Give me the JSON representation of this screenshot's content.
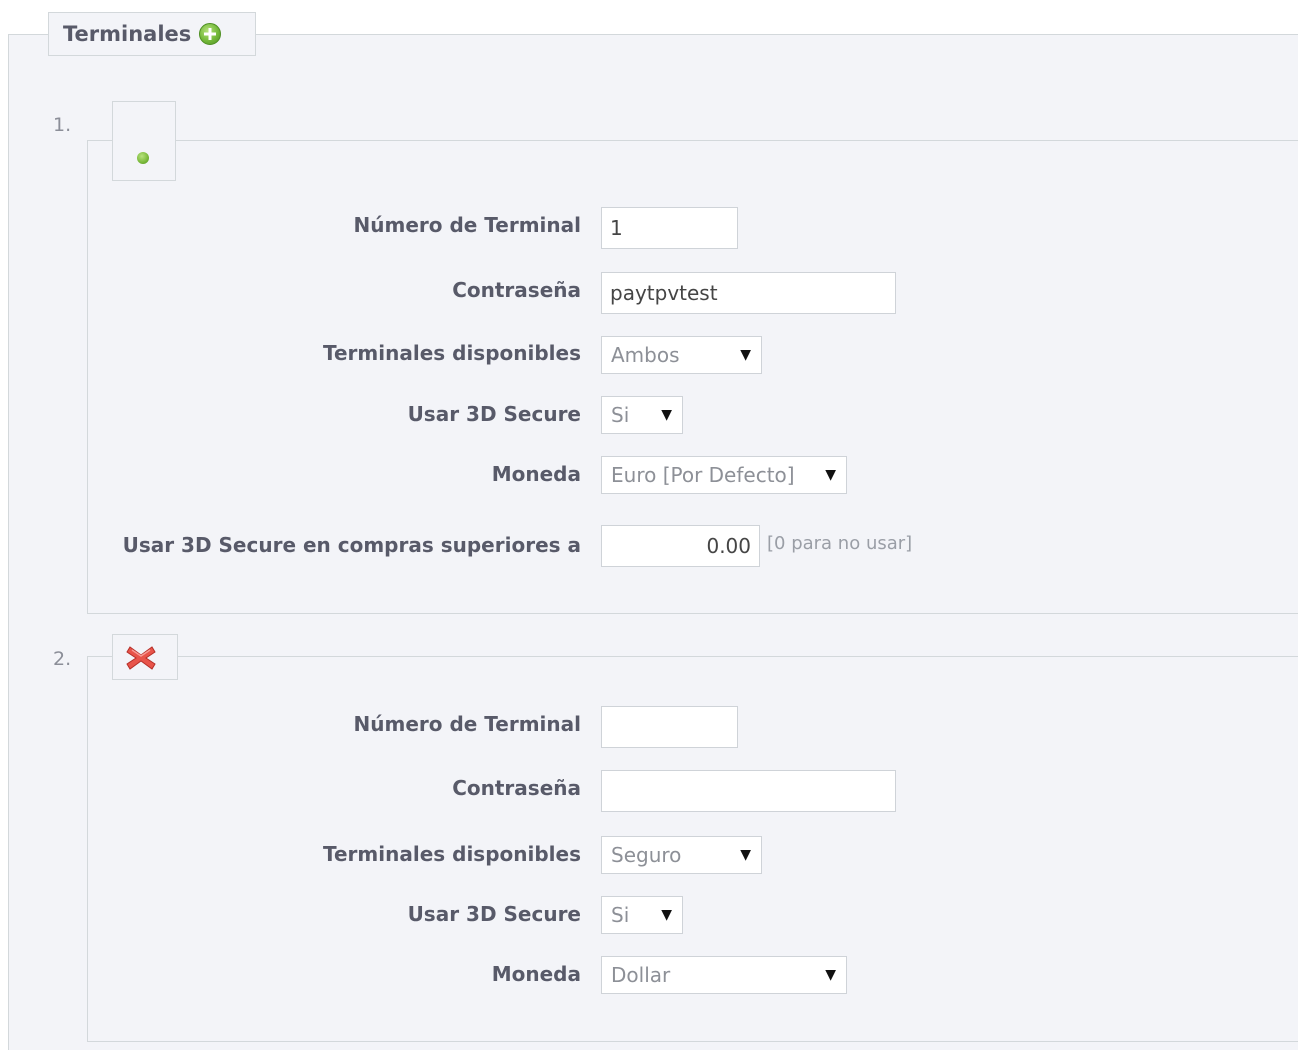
{
  "section": {
    "title": "Terminales",
    "add_icon": "plus-circle-icon"
  },
  "colors": {
    "background": "#f3f4f8",
    "border": "#d3d8db",
    "label": "#585a69",
    "active_green": "#79b83a",
    "delete_red": "#e8544a"
  },
  "terminals": [
    {
      "number_label": "1.",
      "status_icon": "green-dot-icon",
      "fields": {
        "terminal_number": {
          "label": "Número de Terminal",
          "value": "1"
        },
        "password": {
          "label": "Contraseña",
          "value": "paytpvtest"
        },
        "available_terminals": {
          "label": "Terminales disponibles",
          "value": "Ambos"
        },
        "use_3d_secure": {
          "label": "Usar 3D Secure",
          "value": "Si"
        },
        "currency": {
          "label": "Moneda",
          "value": "Euro [Por Defecto]"
        },
        "secure_threshold": {
          "label": "Usar 3D Secure en compras superiores a",
          "value": "0.00",
          "hint": "[0 para no usar]"
        }
      }
    },
    {
      "number_label": "2.",
      "status_icon": "delete-x-icon",
      "fields": {
        "terminal_number": {
          "label": "Número de Terminal",
          "value": ""
        },
        "password": {
          "label": "Contraseña",
          "value": ""
        },
        "available_terminals": {
          "label": "Terminales disponibles",
          "value": "Seguro"
        },
        "use_3d_secure": {
          "label": "Usar 3D Secure",
          "value": "Si"
        },
        "currency": {
          "label": "Moneda",
          "value": "Dollar"
        }
      }
    }
  ]
}
